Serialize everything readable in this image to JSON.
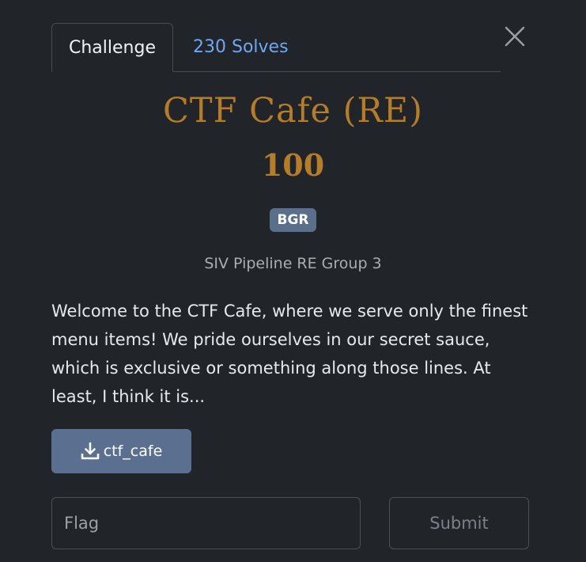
{
  "tabs": {
    "challenge_label": "Challenge",
    "solves_label": "230 Solves"
  },
  "challenge": {
    "title": "CTF Cafe (RE)",
    "points": "100",
    "tag": "BGR",
    "subtitle": "SIV Pipeline RE Group 3",
    "description": "Welcome to the CTF Cafe, where we serve only the finest menu items! We pride ourselves in our secret sauce, which is exclusive or something along those lines. At least, I think it is..."
  },
  "download": {
    "label": "ctf_cafe",
    "icon": "download-icon"
  },
  "form": {
    "flag_placeholder": "Flag",
    "flag_value": "",
    "submit_label": "Submit"
  },
  "colors": {
    "background": "#212428",
    "title": "#b57d2a",
    "link": "#6ea8f5",
    "badge": "#5a6f8c",
    "button": "#5b7090"
  }
}
